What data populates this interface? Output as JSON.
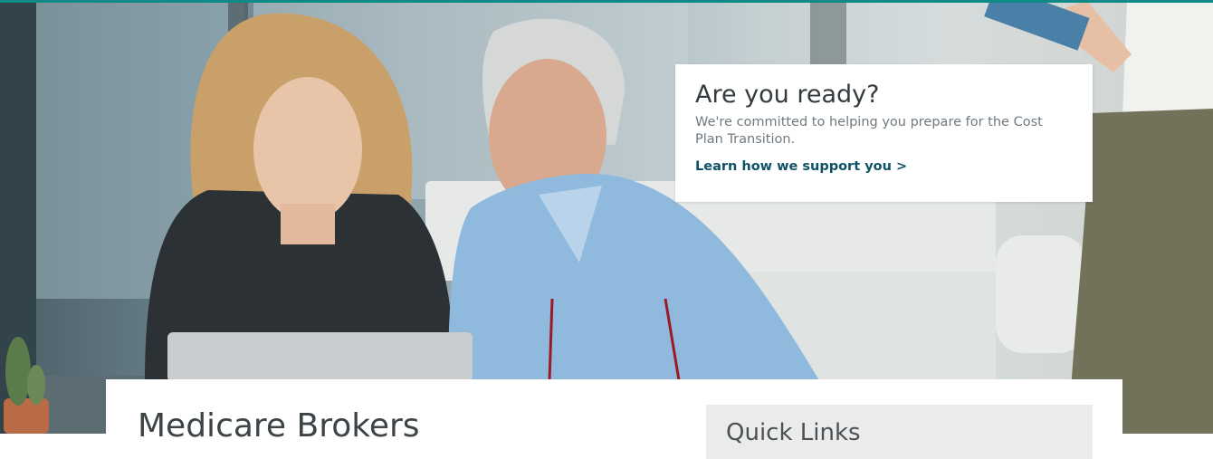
{
  "promo": {
    "title": "Are you ready?",
    "body": "We're committed to helping you prepare for the Cost Plan Transition.",
    "link_label": "Learn how we support you >"
  },
  "main": {
    "section_title": "Medicare Brokers",
    "quick_links_title": "Quick Links"
  },
  "colors": {
    "accent_bar": "#0f8a86",
    "link": "#0f5266",
    "heading": "#333b3f",
    "body_text": "#6f7a80",
    "quick_links_bg": "#ebebeb"
  }
}
